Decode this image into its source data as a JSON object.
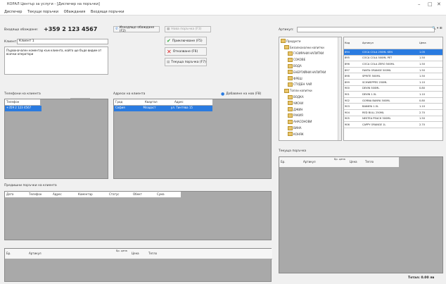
{
  "window": {
    "title": "КОРАЛ Център за услуги - [Диспечер на поръчки]",
    "controls": [
      "–",
      "□",
      "✕"
    ]
  },
  "menu": [
    "Диспечер",
    "Текущи поръчки",
    "Обаждания",
    "Входящи поръчки"
  ],
  "call": {
    "incoming_label": "Входящо обаждане:",
    "phone": "+359 2 123 4567",
    "client_label": "Клиент:",
    "client_value": "Клиент 1",
    "note": "Първоначален коментар към клиента, който ще бъде видим от всички оператори",
    "save_label": "Запис"
  },
  "actions": {
    "outgoing_label": "Изходящо обаждане (F2)",
    "new_order": "Нова поръчка (F3)",
    "accept": "Приключване (F5)",
    "cancel": "Отказване (F6)",
    "history": "Текуща поръчка (F7)"
  },
  "phones_panel": {
    "title": "Телефони на клиента",
    "header": [
      "Телефон"
    ],
    "rows": [
      [
        "+359 2 123 4567"
      ]
    ]
  },
  "addresses_panel": {
    "title": "Адреси на клиента",
    "add_label": "Добавяне на нов (F8)",
    "header": [
      "Град",
      "Квартал",
      "Адрес"
    ],
    "rows": [
      [
        "София",
        "Младост",
        "ул. Тинтява 15"
      ]
    ]
  },
  "history_panel": {
    "title": "Предишни поръчки на клиента",
    "header": [
      "Дата",
      "Телефон",
      "Адрес",
      "Коментар",
      "Статус",
      "Обект",
      "Сума"
    ]
  },
  "order_items_panel": {
    "header": [
      "Бр.",
      "Артикул",
      "Бр. цена",
      "Цена",
      "Тегло"
    ]
  },
  "search": {
    "label": "Артикул:",
    "placeholder": "",
    "button": "🔍 ▾ ⊞"
  },
  "tree": [
    {
      "label": "Продукти",
      "level": 0
    },
    {
      "label": "Безалкохолни напитки",
      "level": 1
    },
    {
      "label": "ГАЗИРАНИ НАПИТКИ",
      "level": 2
    },
    {
      "label": "СОКОВЕ",
      "level": 2
    },
    {
      "label": "ВОДА",
      "level": 2
    },
    {
      "label": "ЕНЕРГИЙНИ НАПИТКИ",
      "level": 2
    },
    {
      "label": "ФРЕШ",
      "level": 2
    },
    {
      "label": "СТУДЕН ЧАЙ",
      "level": 2
    },
    {
      "label": "Топли напитки",
      "level": 1
    },
    {
      "label": "ВОДКА",
      "level": 2
    },
    {
      "label": "УИСКИ",
      "level": 2
    },
    {
      "label": "ДЖИН",
      "level": 2
    },
    {
      "label": "РАКИЯ",
      "level": 2
    },
    {
      "label": "АНАСОНОВИ",
      "level": 2
    },
    {
      "label": "ВИНА",
      "level": 2
    },
    {
      "label": "КОНЯК",
      "level": 2
    }
  ],
  "product_list": {
    "header": [
      "Код",
      "Артикул",
      "Цена"
    ],
    "rows": [
      [
        "894",
        "COCA COLA 250ML KEN",
        "1.05"
      ],
      [
        "895",
        "COCA COLA 500ML PET",
        "1.50"
      ],
      [
        "896",
        "COCA COLA ZERO 500ML",
        "1.50"
      ],
      [
        "897",
        "FANTA ORANGE 500ML",
        "1.50"
      ],
      [
        "898",
        "SPRITE 500ML",
        "1.50"
      ],
      [
        "899",
        "SCHWEPPES 250ML",
        "1.10"
      ],
      [
        "900",
        "DEVIN 500ML",
        "0.80"
      ],
      [
        "901",
        "DEVIN 1.5L",
        "1.10"
      ],
      [
        "902",
        "GORNA BANYA 500ML",
        "0.80"
      ],
      [
        "903",
        "BANKYA 1.5L",
        "1.10"
      ],
      [
        "904",
        "RED BULL 250ML",
        "2.70"
      ],
      [
        "905",
        "NESTEA PEACH 500ML",
        "1.50"
      ],
      [
        "906",
        "CAPPY ORANGE 1L",
        "2.70"
      ]
    ]
  },
  "current_order": {
    "title": "Текуща поръчка",
    "header": [
      "Бр.",
      "Артикул",
      "Бр. цена",
      "Цена",
      "Тегло"
    ],
    "total_label": "Тотал: 0.00 лв"
  }
}
